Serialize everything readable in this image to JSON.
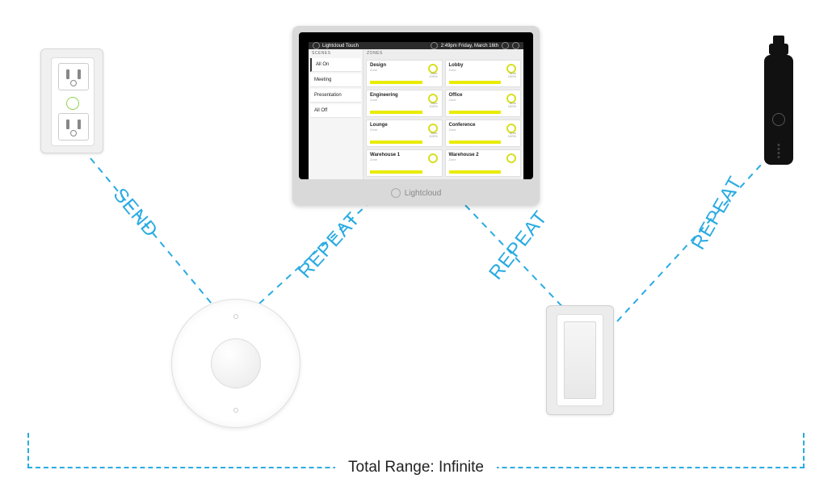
{
  "links": {
    "send": "SEND",
    "repeat": "REPEAT"
  },
  "range_label": "Total Range: Infinite",
  "tablet": {
    "brand": "Lightcloud",
    "title": "Lightcloud Touch",
    "clock": "2:49pm Friday, March 16th",
    "scenes_header": "SCENES",
    "zones_header": "ZONES",
    "scenes": [
      "All On",
      "Meeting",
      "Presentation",
      "All Off"
    ],
    "zone_sub": "Zone",
    "zone_stat1": "Auto",
    "zone_stat2": "100%",
    "zones": [
      "Design",
      "Lobby",
      "Engineering",
      "Office",
      "Lounge",
      "Conference",
      "Warehouse 1",
      "Warehouse 2"
    ]
  },
  "devices": {
    "outlet": "smart-outlet",
    "sensor": "occupancy-sensor",
    "switch": "wall-switch",
    "dongle": "wireless-controller",
    "tablet": "touch-panel"
  }
}
